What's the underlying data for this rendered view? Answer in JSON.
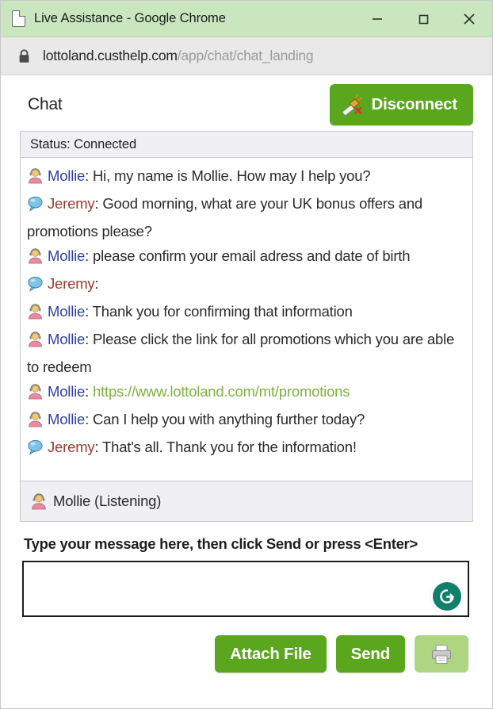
{
  "window": {
    "title": "Live Assistance - Google Chrome",
    "doc_icon": "document-icon",
    "minimize_label": "Minimize",
    "maximize_label": "Maximize",
    "close_label": "Close"
  },
  "urlbar": {
    "lock_icon": "lock-icon",
    "host": "lottoland.custhelp.com",
    "path": "/app/chat/chat_landing"
  },
  "chat": {
    "title": "Chat",
    "disconnect_label": "Disconnect",
    "disconnect_icon": "plug-disconnect-icon",
    "status": "Status: Connected",
    "listening": "Mollie (Listening)",
    "listening_icon": "agent-avatar-icon",
    "messages": [
      {
        "icon": "agent-avatar-icon",
        "sender": "Mollie",
        "role": "agent",
        "separator": ": ",
        "text": "Hi, my name is Mollie. How may I help you?",
        "link": ""
      },
      {
        "icon": "visitor-bubble-icon",
        "sender": "Jeremy",
        "role": "visitor",
        "separator": ": ",
        "text": "Good morning, what are your UK bonus offers and promotions please?",
        "link": ""
      },
      {
        "icon": "agent-avatar-icon",
        "sender": "Mollie",
        "role": "agent",
        "separator": ": ",
        "text": "please confirm your email adress and date of birth",
        "link": ""
      },
      {
        "icon": "visitor-bubble-icon",
        "sender": "Jeremy",
        "role": "visitor",
        "separator": ": ",
        "text": "",
        "link": ""
      },
      {
        "icon": "agent-avatar-icon",
        "sender": "Mollie",
        "role": "agent",
        "separator": ": ",
        "text": "Thank you for confirming that information",
        "link": ""
      },
      {
        "icon": "agent-avatar-icon",
        "sender": "Mollie",
        "role": "agent",
        "separator": ": ",
        "text": "Please click the link for all promotions which you are able to redeem",
        "link": ""
      },
      {
        "icon": "agent-avatar-icon",
        "sender": "Mollie",
        "role": "agent",
        "separator": ": ",
        "text": "",
        "link": "https://www.lottoland.com/mt/promotions"
      },
      {
        "icon": "agent-avatar-icon",
        "sender": "Mollie",
        "role": "agent",
        "separator": ": ",
        "text": "Can I help you with anything further today?",
        "link": ""
      },
      {
        "icon": "visitor-bubble-icon",
        "sender": "Jeremy",
        "role": "visitor",
        "separator": ": ",
        "text": "That's all. Thank you for the information!",
        "link": ""
      }
    ]
  },
  "compose": {
    "hint": "Type your message here, then click Send or press <Enter>",
    "input_value": "",
    "input_placeholder": "",
    "grammar_icon": "grammarly-refresh-icon"
  },
  "actions": {
    "attach_label": "Attach File",
    "send_label": "Send",
    "print_icon": "printer-icon"
  },
  "colors": {
    "titlebar_green": "#c9e6bf",
    "button_green": "#5aa61c",
    "print_green": "#aed581",
    "agent_name": "#2f3f9e",
    "visitor_name": "#9a3b2c",
    "link_green": "#7fb040",
    "grammar_teal": "#11806a"
  }
}
